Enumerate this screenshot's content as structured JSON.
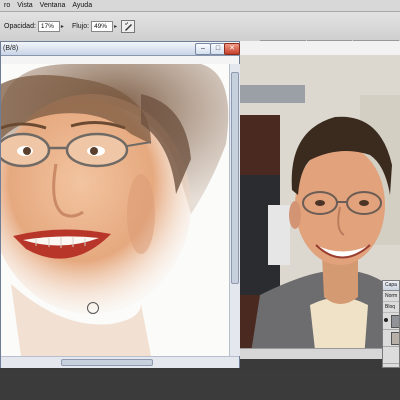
{
  "menubar": {
    "items": [
      {
        "label": "ro"
      },
      {
        "label": "Vista"
      },
      {
        "label": "Ventana"
      },
      {
        "label": "Ayuda"
      }
    ]
  },
  "options": {
    "opacity_label": "Opacidad:",
    "opacity_value": "17%",
    "flow_label": "Flujo:",
    "flow_value": "49%"
  },
  "caricature_window": {
    "title": "(B/8)"
  },
  "layers_panel": {
    "title": "Capa",
    "blend_label": "Norm",
    "lock_label": "Bloq"
  },
  "colors": {
    "skin": "#e9b58f",
    "lips": "#b8352a",
    "hair": "#6b4a32",
    "accent": "#c4402a"
  }
}
